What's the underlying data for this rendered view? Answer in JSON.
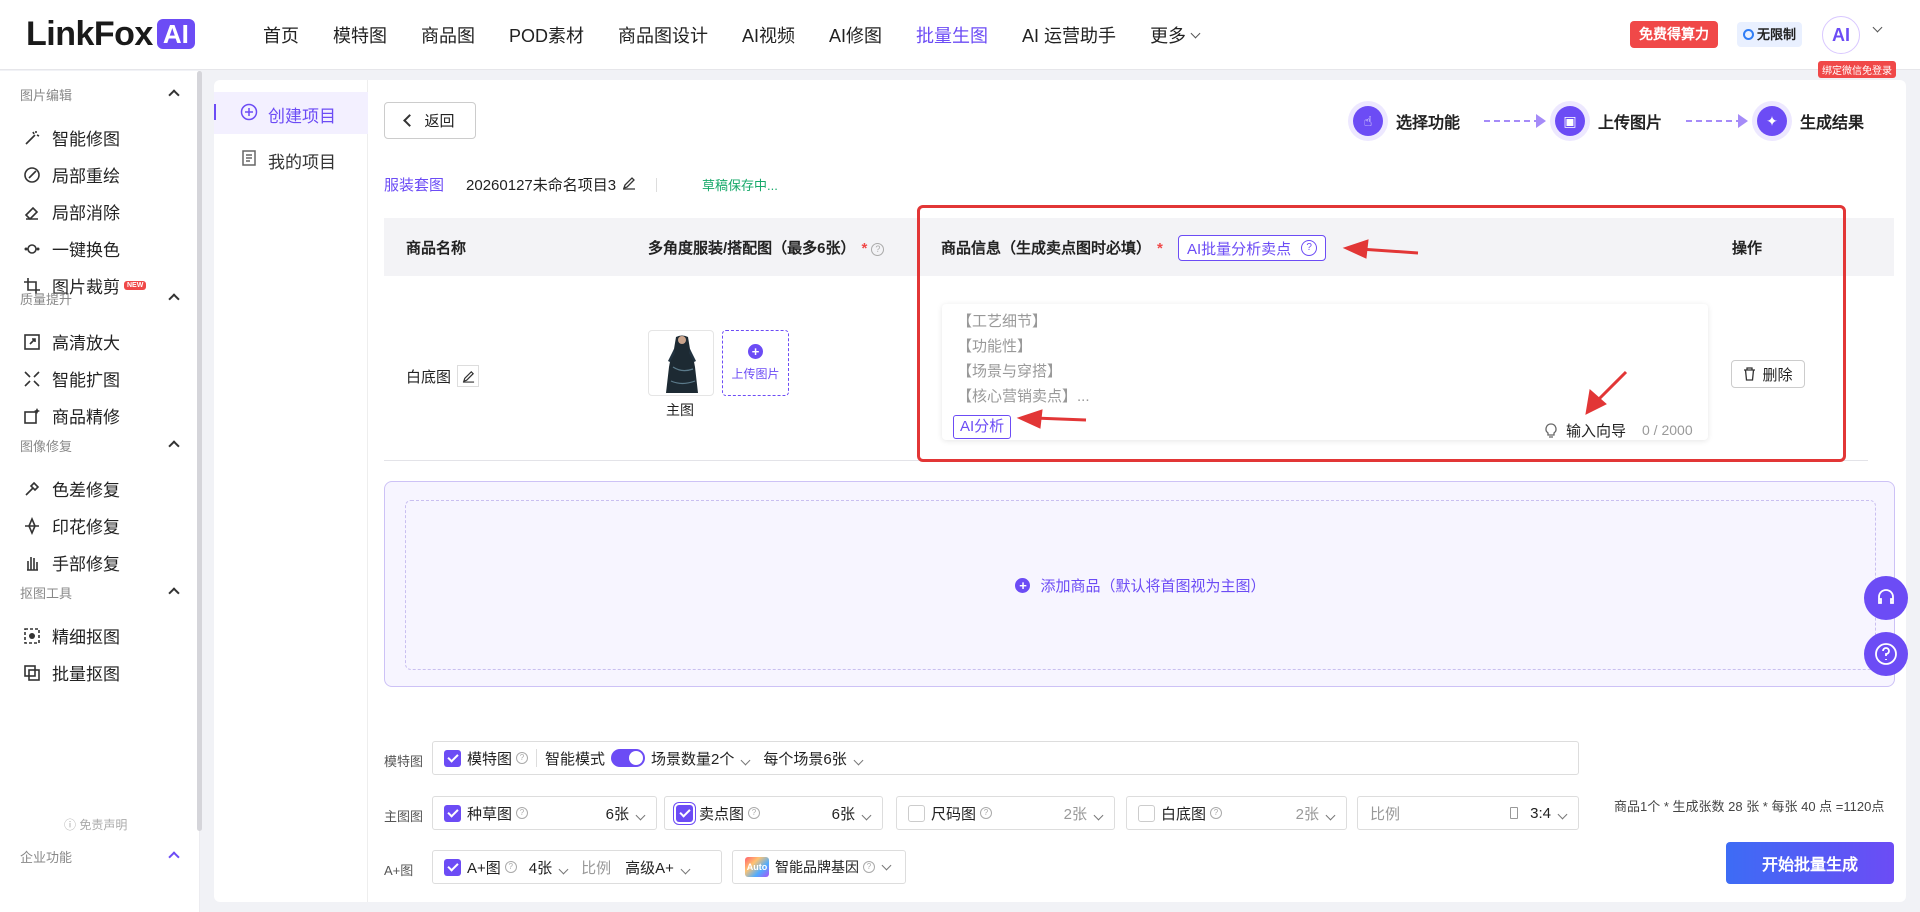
{
  "brand": {
    "name": "LinkFox",
    "ai_badge": "AI"
  },
  "nav": {
    "items": [
      "首页",
      "模特图",
      "商品图",
      "POD素材",
      "商品图设计",
      "AI视频",
      "AI修图",
      "批量生图",
      "AI 运营助手",
      "更多"
    ],
    "active": "批量生图"
  },
  "header": {
    "free_button": "免费得算力",
    "unlimited_badge": "无限制",
    "avatar_text": "AI",
    "avatar_tag": "绑定微信免登录"
  },
  "sidebar": {
    "groups": [
      {
        "title": "图片编辑",
        "items": [
          "智能修图",
          "局部重绘",
          "局部消除",
          "一键换色",
          "图片裁剪"
        ]
      },
      {
        "title": "质量提升",
        "items": [
          "高清放大",
          "智能扩图",
          "商品精修"
        ]
      },
      {
        "title": "图像修复",
        "items": [
          "色差修复",
          "印花修复",
          "手部修复"
        ]
      },
      {
        "title": "抠图工具",
        "items": [
          "精细抠图",
          "批量抠图"
        ]
      },
      {
        "title": "企业功能",
        "items": []
      }
    ],
    "new_badge": "NEW",
    "disclaimer": "免责声明"
  },
  "subnav": {
    "create": "创建项目",
    "mine": "我的项目"
  },
  "toolbar": {
    "back": "返回"
  },
  "steps": [
    "选择功能",
    "上传图片",
    "生成结果"
  ],
  "project": {
    "type": "服装套图",
    "name": "20260127未命名项目3",
    "draft_status": "草稿保存中..."
  },
  "table": {
    "headers": {
      "name": "商品名称",
      "images": "多角度服装/搭配图（最多6张）",
      "info": "商品信息（生成卖点图时必填）",
      "action": "操作"
    },
    "required_mark": "*",
    "ai_batch_button": "AI批量分析卖点",
    "row": {
      "name": "白底图",
      "thumb_caption": "主图",
      "upload_label": "上传图片",
      "info_placeholder_lines": [
        "【工艺细节】",
        "【功能性】",
        "【场景与穿搭】",
        "【核心营销卖点】..."
      ],
      "ai_analyze": "AI分析",
      "guide": "输入向导",
      "char_count": "0 / 2000",
      "delete": "删除"
    }
  },
  "add_product": "添加商品（默认将首图视为主图）",
  "options": {
    "model_row": {
      "label": "模特图",
      "check": "模特图",
      "smart_mode": "智能模式",
      "scene_count": "场景数量2个",
      "per_scene": "每个场景6张"
    },
    "main_row": {
      "label": "主图图",
      "items": [
        {
          "name": "种草图",
          "count": "6张",
          "checked": true
        },
        {
          "name": "卖点图",
          "count": "6张",
          "checked": true
        },
        {
          "name": "尺码图",
          "count": "2张",
          "checked": false
        },
        {
          "name": "白底图",
          "count": "2张",
          "checked": false
        }
      ],
      "ratio_label": "比例",
      "ratio_value": "3:4"
    },
    "aplus_row": {
      "label": "A+图",
      "check": "A+图",
      "count": "4张",
      "ratio_label": "比例",
      "ratio_value": "高级A+",
      "brand_gene": "智能品牌基因",
      "auto_text": "Auto"
    }
  },
  "summary": "商品1个 * 生成张数 28 张 * 每张 40 点 =1120点",
  "start_button": "开始批量生成"
}
